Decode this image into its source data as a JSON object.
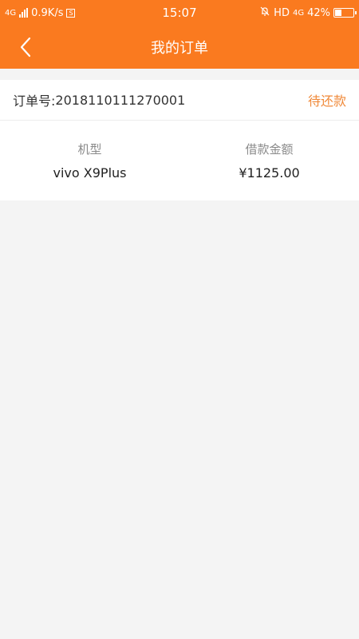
{
  "statusbar": {
    "network_left": "4G",
    "speed": "0.9K/s",
    "s_badge": "S",
    "time": "15:07",
    "hd": "HD",
    "network_right": "4G",
    "battery": "42%",
    "battery_level": 0.42
  },
  "navbar": {
    "title": "我的订单",
    "back_icon": "chevron-left-icon"
  },
  "order": {
    "label": "订单号:",
    "number": "2018110111270001",
    "status": "待还款",
    "status_color": "#f08a3a"
  },
  "details": {
    "model_header": "机型",
    "model_value": "vivo X9Plus",
    "amount_header": "借款金额",
    "amount_value": "¥1125.00"
  },
  "colors": {
    "accent": "#fa7a1f",
    "background": "#f4f4f4"
  }
}
